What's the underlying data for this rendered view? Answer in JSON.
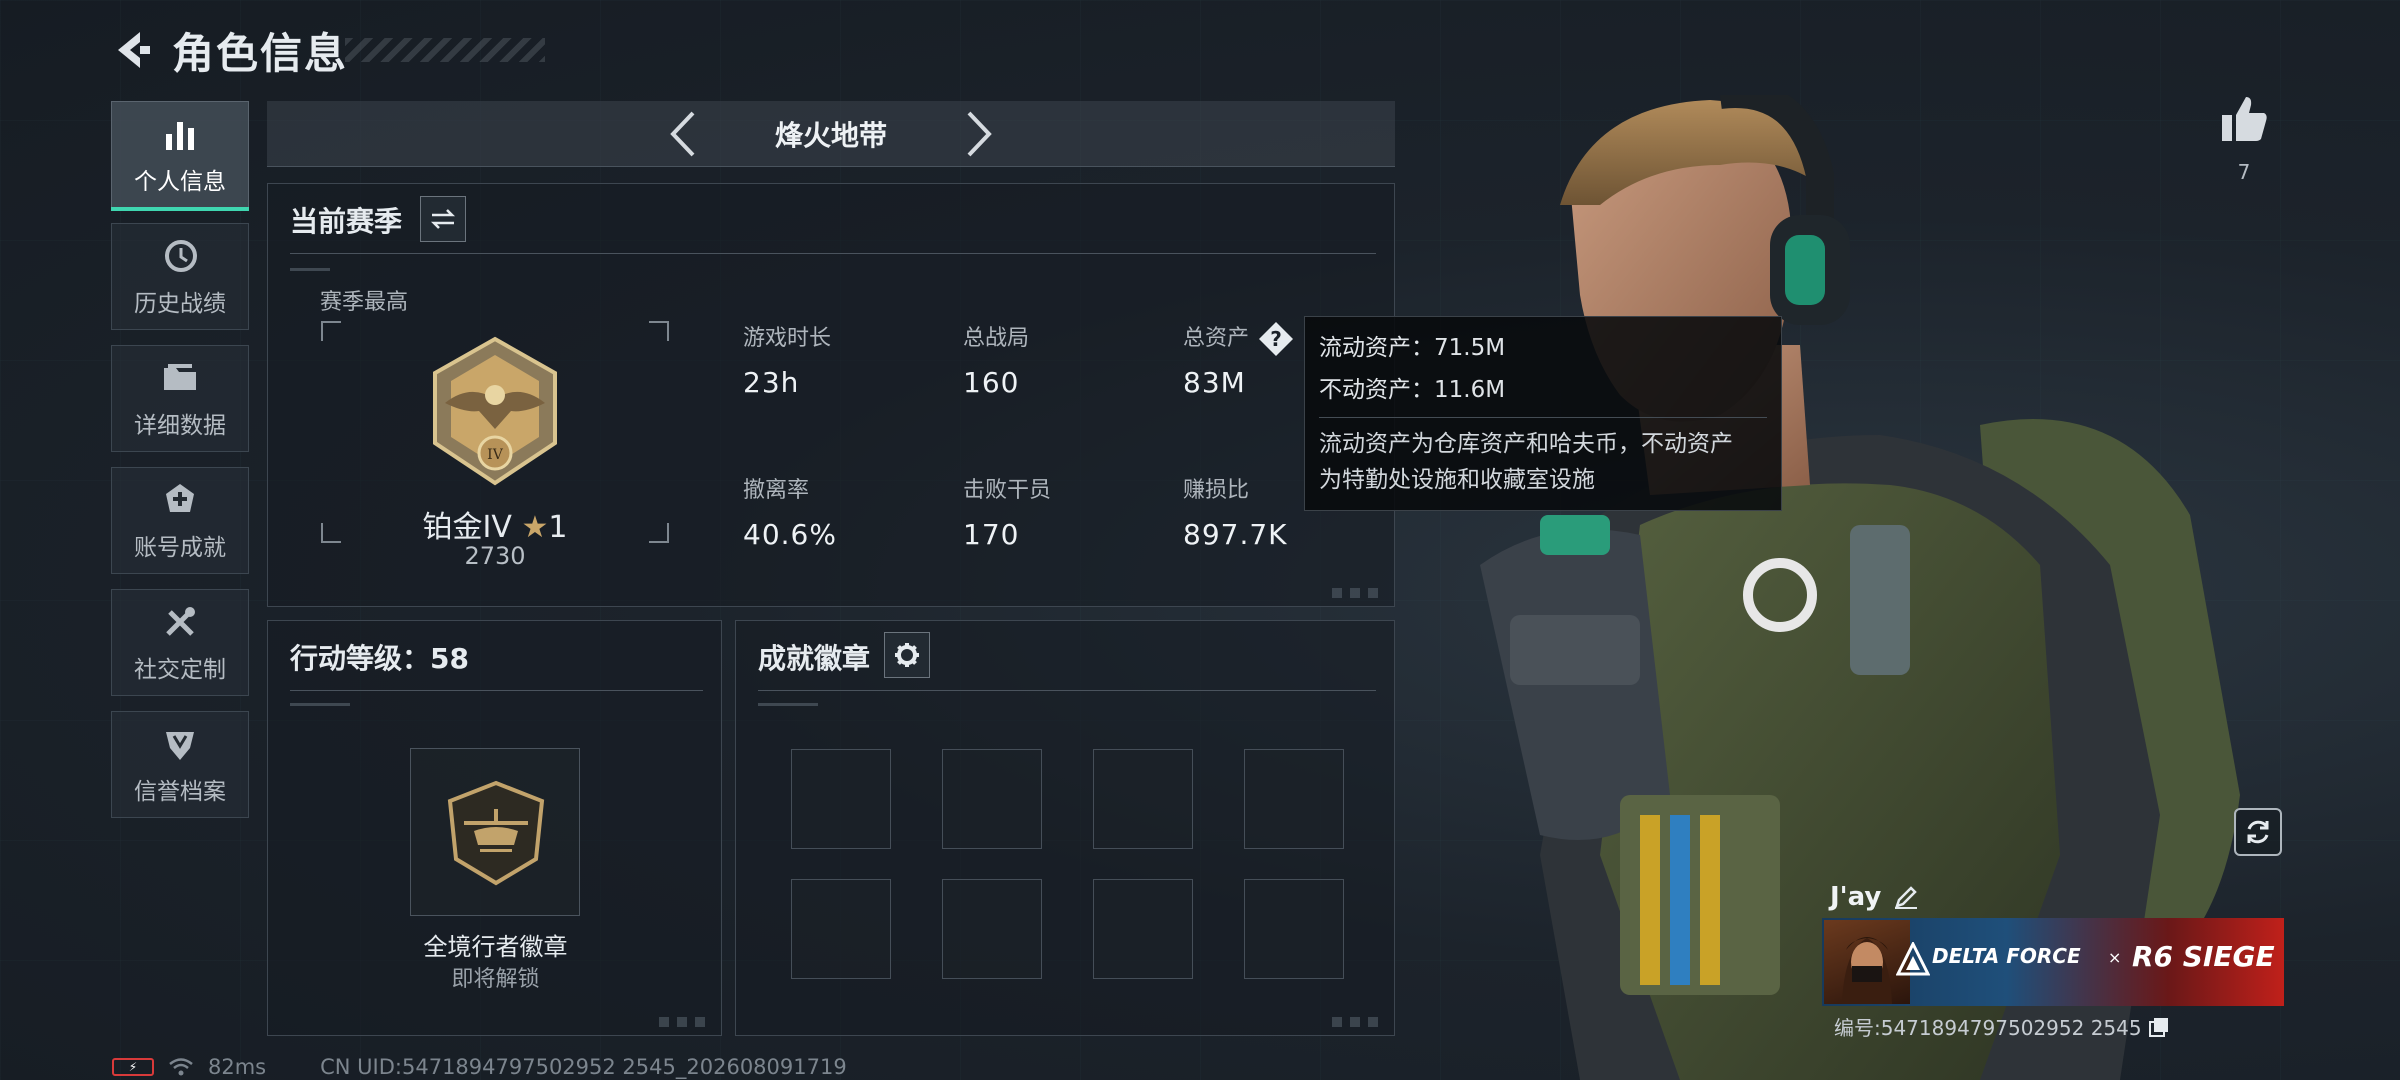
{
  "header": {
    "title": "角色信息"
  },
  "sidebar": {
    "items": [
      {
        "label": "个人信息",
        "icon": "bar-chart-icon",
        "active": true
      },
      {
        "label": "历史战绩",
        "icon": "clock-history-icon"
      },
      {
        "label": "详细数据",
        "icon": "folder-icon"
      },
      {
        "label": "账号成就",
        "icon": "medal-plus-icon"
      },
      {
        "label": "社交定制",
        "icon": "tools-icon"
      },
      {
        "label": "信誉档案",
        "icon": "shield-badge-icon"
      }
    ]
  },
  "mode_tab": {
    "title": "烽火地带"
  },
  "season": {
    "title": "当前赛季",
    "best_label": "赛季最高",
    "rank_name": "铂金IV",
    "rank_stars": "1",
    "rank_score": "2730",
    "stats": [
      {
        "label": "游戏时长",
        "value": "23h"
      },
      {
        "label": "总战局",
        "value": "160"
      },
      {
        "label": "总资产",
        "value": "83M"
      },
      {
        "label": "撤离率",
        "value": "40.6%"
      },
      {
        "label": "击败干员",
        "value": "170"
      },
      {
        "label": "赚损比",
        "value": "897.7K"
      }
    ]
  },
  "tooltip": {
    "liquid": "流动资产：71.5M",
    "fixed": "不动资产：11.6M",
    "note_line1": "流动资产为仓库资产和哈夫币，不动资产",
    "note_line2": "为特勤处设施和收藏室设施"
  },
  "level": {
    "title": "行动等级：58",
    "badge_name": "全境行者徽章",
    "badge_status": "即将解锁"
  },
  "achievements": {
    "title": "成就徽章",
    "slots": 8
  },
  "footer": {
    "ping": "82ms",
    "uid": "CN UID:5471894797502952 2545_202608091719"
  },
  "player": {
    "likes": "7",
    "name": "J'ay",
    "banner_left": "DELTA FORCE",
    "banner_x": "×",
    "banner_right": "R6 SIEGE",
    "id": "编号:5471894797502952 2545"
  },
  "colors": {
    "accent": "#3fd6b0",
    "background": "#1a2129",
    "battery": "#d83a3a"
  }
}
